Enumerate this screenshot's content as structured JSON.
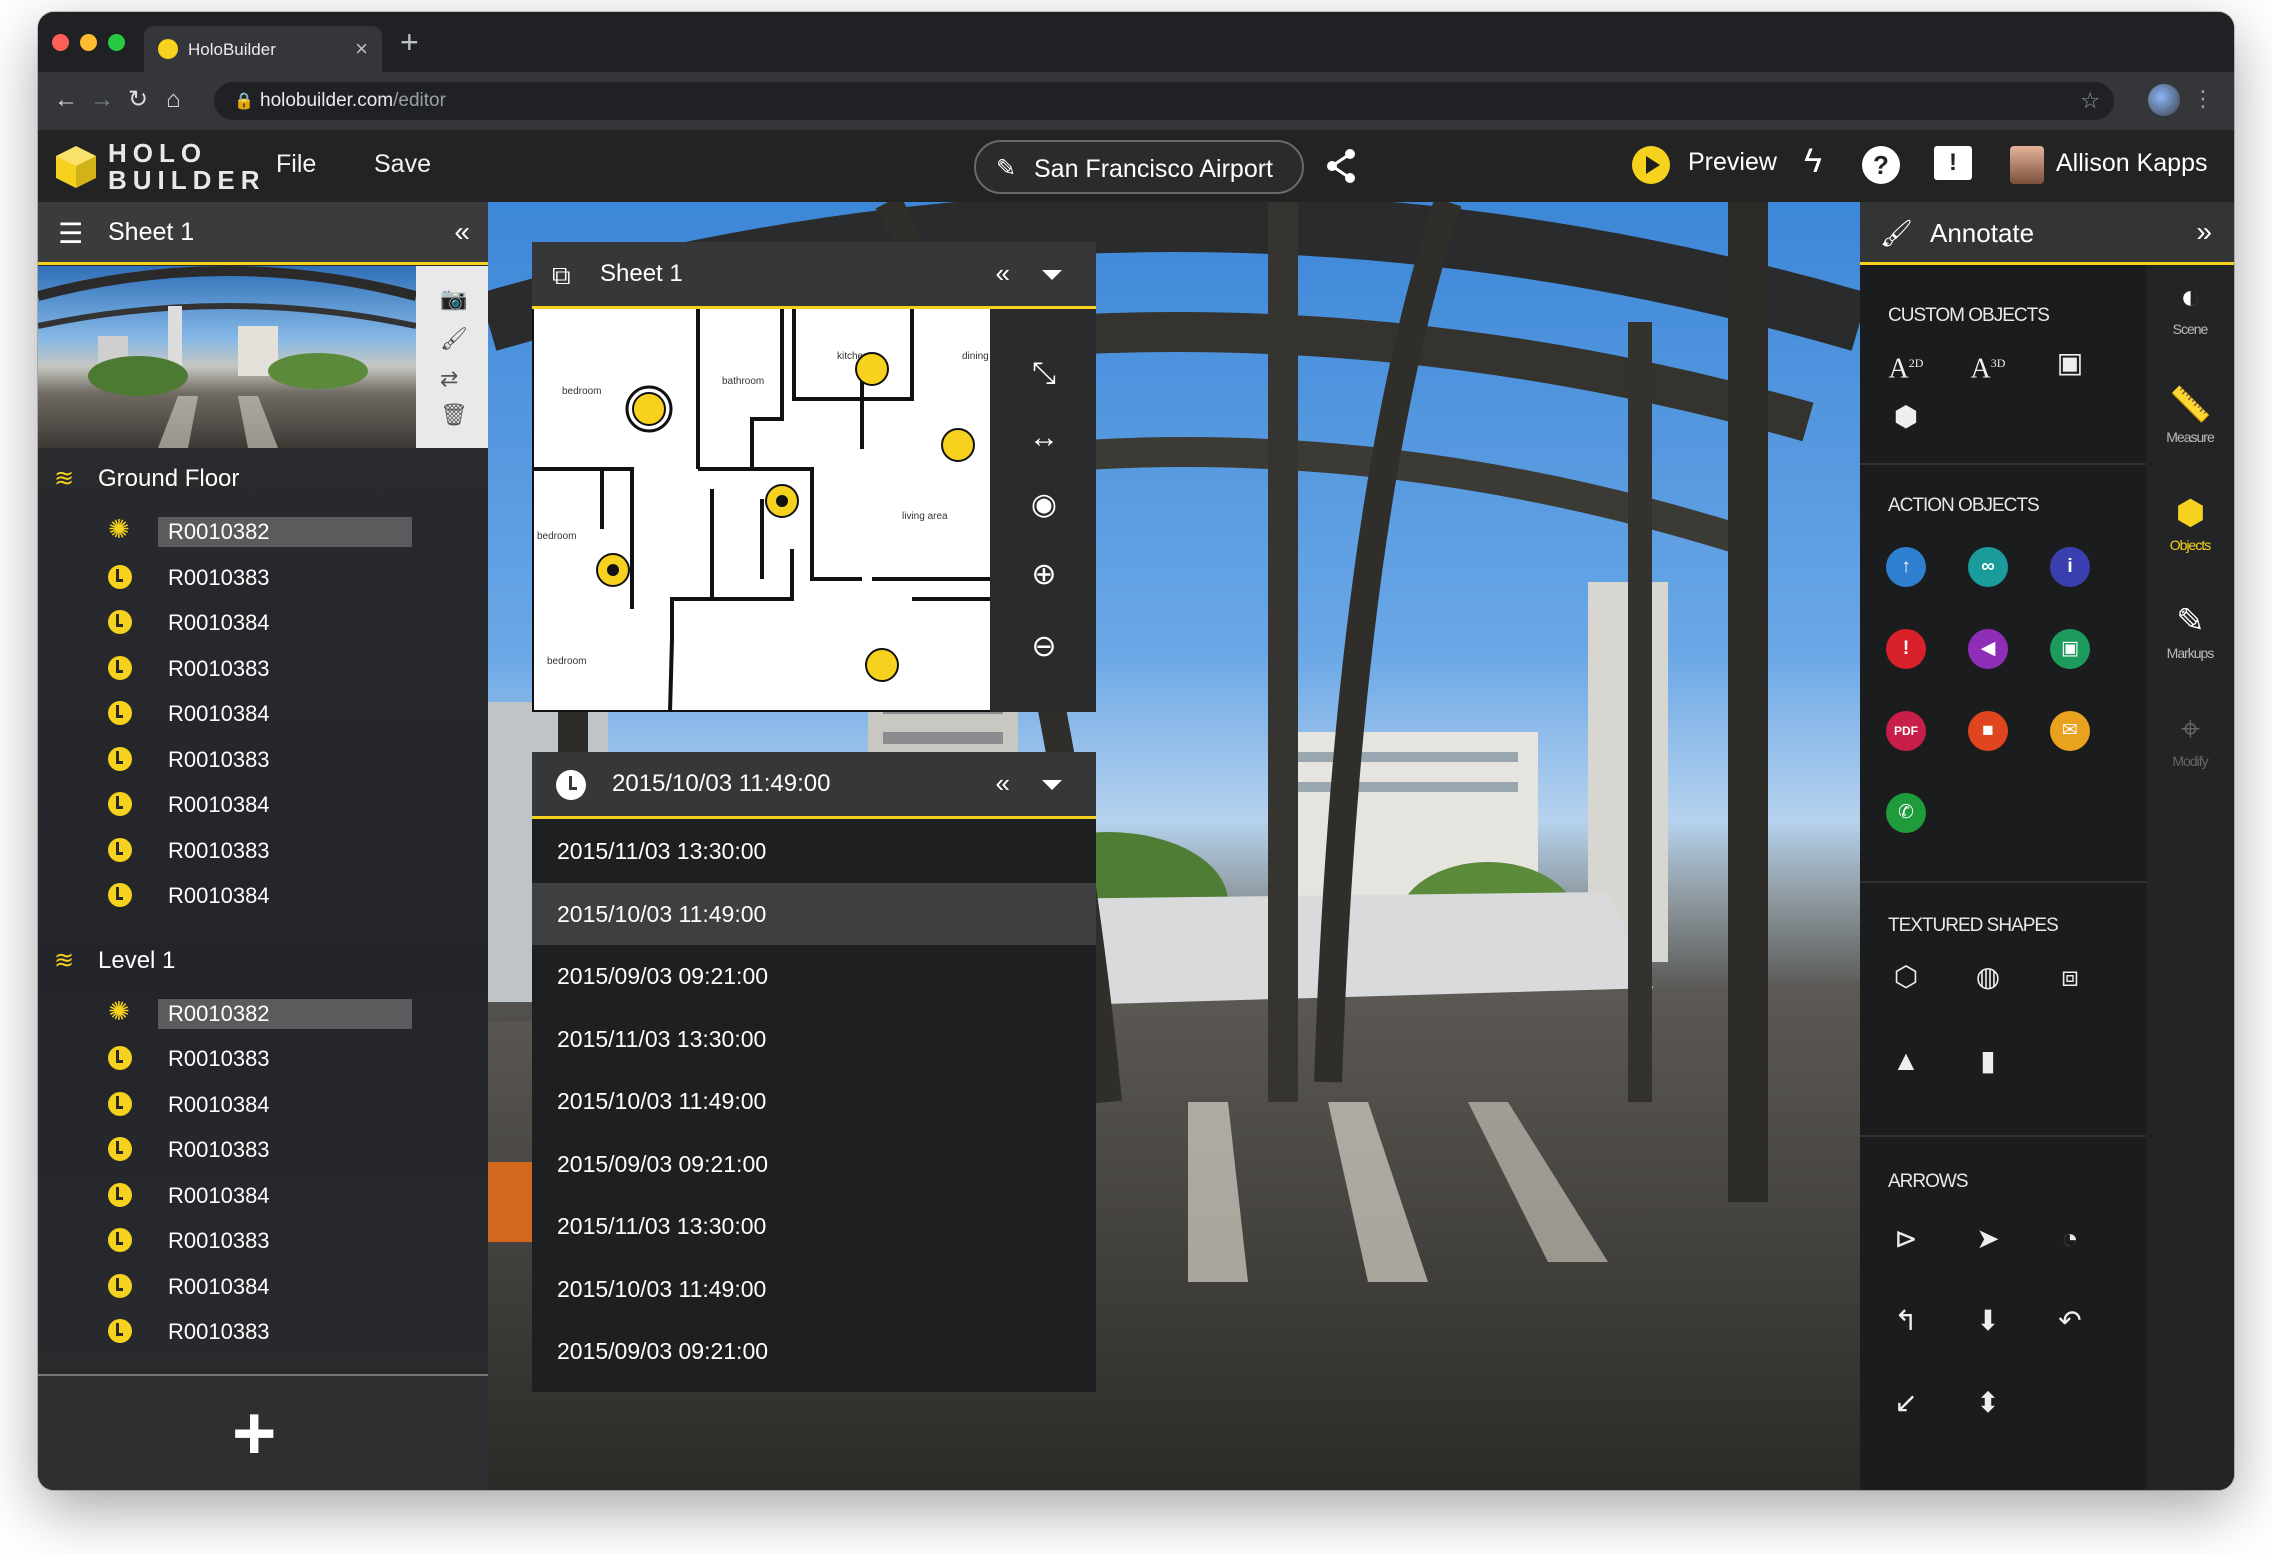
{
  "browser": {
    "tab_title": "HoloBuilder",
    "tab_close": "×",
    "new_tab": "+",
    "url_host": "holobuilder.com",
    "url_path": "/editor",
    "nav_back": "←",
    "nav_forward": "→",
    "nav_reload": "↻",
    "nav_home": "⌂",
    "star": "☆",
    "menu": "⋮",
    "traffic_colors": [
      "#ff5f57",
      "#febc2e",
      "#28c840"
    ]
  },
  "header": {
    "logo_line1": "HOLO",
    "logo_line2": "BUILDER",
    "menu": {
      "file": "File",
      "save": "Save"
    },
    "project_name": "San Francisco Airport",
    "preview_label": "Preview",
    "help": "?",
    "feedback": "!",
    "user_name": "Allison Kapps",
    "accent_color": "#f6d21e"
  },
  "left_panel": {
    "title": "Sheet 1",
    "collapse": "«",
    "groups": [
      {
        "title": "Ground Floor",
        "scans": [
          {
            "label": "R0010382",
            "selected": true,
            "icon": "pano-icon"
          },
          {
            "label": "R0010383",
            "selected": false,
            "icon": "clock-icon"
          },
          {
            "label": "R0010384",
            "selected": false,
            "icon": "clock-icon"
          },
          {
            "label": "R0010383",
            "selected": false,
            "icon": "clock-icon"
          },
          {
            "label": "R0010384",
            "selected": false,
            "icon": "clock-icon"
          },
          {
            "label": "R0010383",
            "selected": false,
            "icon": "clock-icon"
          },
          {
            "label": "R0010384",
            "selected": false,
            "icon": "clock-icon"
          },
          {
            "label": "R0010383",
            "selected": false,
            "icon": "clock-icon"
          },
          {
            "label": "R0010384",
            "selected": false,
            "icon": "clock-icon"
          }
        ]
      },
      {
        "title": "Level 1",
        "scans": [
          {
            "label": "R0010382",
            "selected": true,
            "icon": "pano-icon"
          },
          {
            "label": "R0010383",
            "selected": false,
            "icon": "clock-icon"
          },
          {
            "label": "R0010384",
            "selected": false,
            "icon": "clock-icon"
          },
          {
            "label": "R0010383",
            "selected": false,
            "icon": "clock-icon"
          },
          {
            "label": "R0010384",
            "selected": false,
            "icon": "clock-icon"
          },
          {
            "label": "R0010383",
            "selected": false,
            "icon": "clock-icon"
          },
          {
            "label": "R0010384",
            "selected": false,
            "icon": "clock-icon"
          },
          {
            "label": "R0010383",
            "selected": false,
            "icon": "clock-icon"
          }
        ]
      }
    ],
    "add": "+"
  },
  "sheet_panel": {
    "title": "Sheet 1",
    "collapse": "«",
    "rooms": [
      "bedroom",
      "bathroom",
      "kitchen",
      "dining",
      "living area",
      "bedroom",
      "bedroom"
    ]
  },
  "time_panel": {
    "current": "2015/10/03 11:49:00",
    "collapse": "«",
    "dates": [
      {
        "label": "2015/11/03 13:30:00",
        "selected": false
      },
      {
        "label": "2015/10/03 11:49:00",
        "selected": true
      },
      {
        "label": "2015/09/03 09:21:00",
        "selected": false
      },
      {
        "label": "2015/11/03 13:30:00",
        "selected": false
      },
      {
        "label": "2015/10/03 11:49:00",
        "selected": false
      },
      {
        "label": "2015/09/03 09:21:00",
        "selected": false
      },
      {
        "label": "2015/11/03 13:30:00",
        "selected": false
      },
      {
        "label": "2015/10/03 11:49:00",
        "selected": false
      },
      {
        "label": "2015/09/03 09:21:00",
        "selected": false
      }
    ]
  },
  "annotate": {
    "title": "Annotate",
    "expand": "»",
    "sections": {
      "custom": "CUSTOM OBJECTS",
      "action": "ACTION OBJECTS",
      "textured": "TEXTURED SHAPES",
      "arrows": "ARROWS"
    },
    "custom_objects": [
      "A2D",
      "A3D"
    ],
    "action_objects": [
      {
        "icon": "arrow-up-icon",
        "color": "#2f7fd0",
        "glyph": "↑"
      },
      {
        "icon": "link-icon",
        "color": "#1a9c9c",
        "glyph": "∞"
      },
      {
        "icon": "info-icon",
        "color": "#3a3fb0",
        "glyph": "i"
      },
      {
        "icon": "alert-icon",
        "color": "#d8202a",
        "glyph": "!"
      },
      {
        "icon": "audio-icon",
        "color": "#8e2db8",
        "glyph": "◀"
      },
      {
        "icon": "image-icon",
        "color": "#1d9b5c",
        "glyph": "▣"
      },
      {
        "icon": "pdf-icon",
        "color": "#c81f4a",
        "glyph": "PDF"
      },
      {
        "icon": "video-icon",
        "color": "#e0461d",
        "glyph": "■"
      },
      {
        "icon": "email-icon",
        "color": "#e8a21e",
        "glyph": "✉"
      },
      {
        "icon": "phone-icon",
        "color": "#1e9b3a",
        "glyph": "✆"
      }
    ],
    "rail": [
      {
        "label": "Scene",
        "icon": "scene-icon",
        "glyph": "◐",
        "state": "normal"
      },
      {
        "label": "Measure",
        "icon": "ruler-icon",
        "glyph": "📏",
        "state": "normal"
      },
      {
        "label": "Objects",
        "icon": "cube-icon",
        "glyph": "⬢",
        "state": "active"
      },
      {
        "label": "Markups",
        "icon": "pen-icon",
        "glyph": "✎",
        "state": "normal"
      },
      {
        "label": "Modify",
        "icon": "modify-icon",
        "glyph": "⌖",
        "state": "disabled"
      }
    ]
  }
}
